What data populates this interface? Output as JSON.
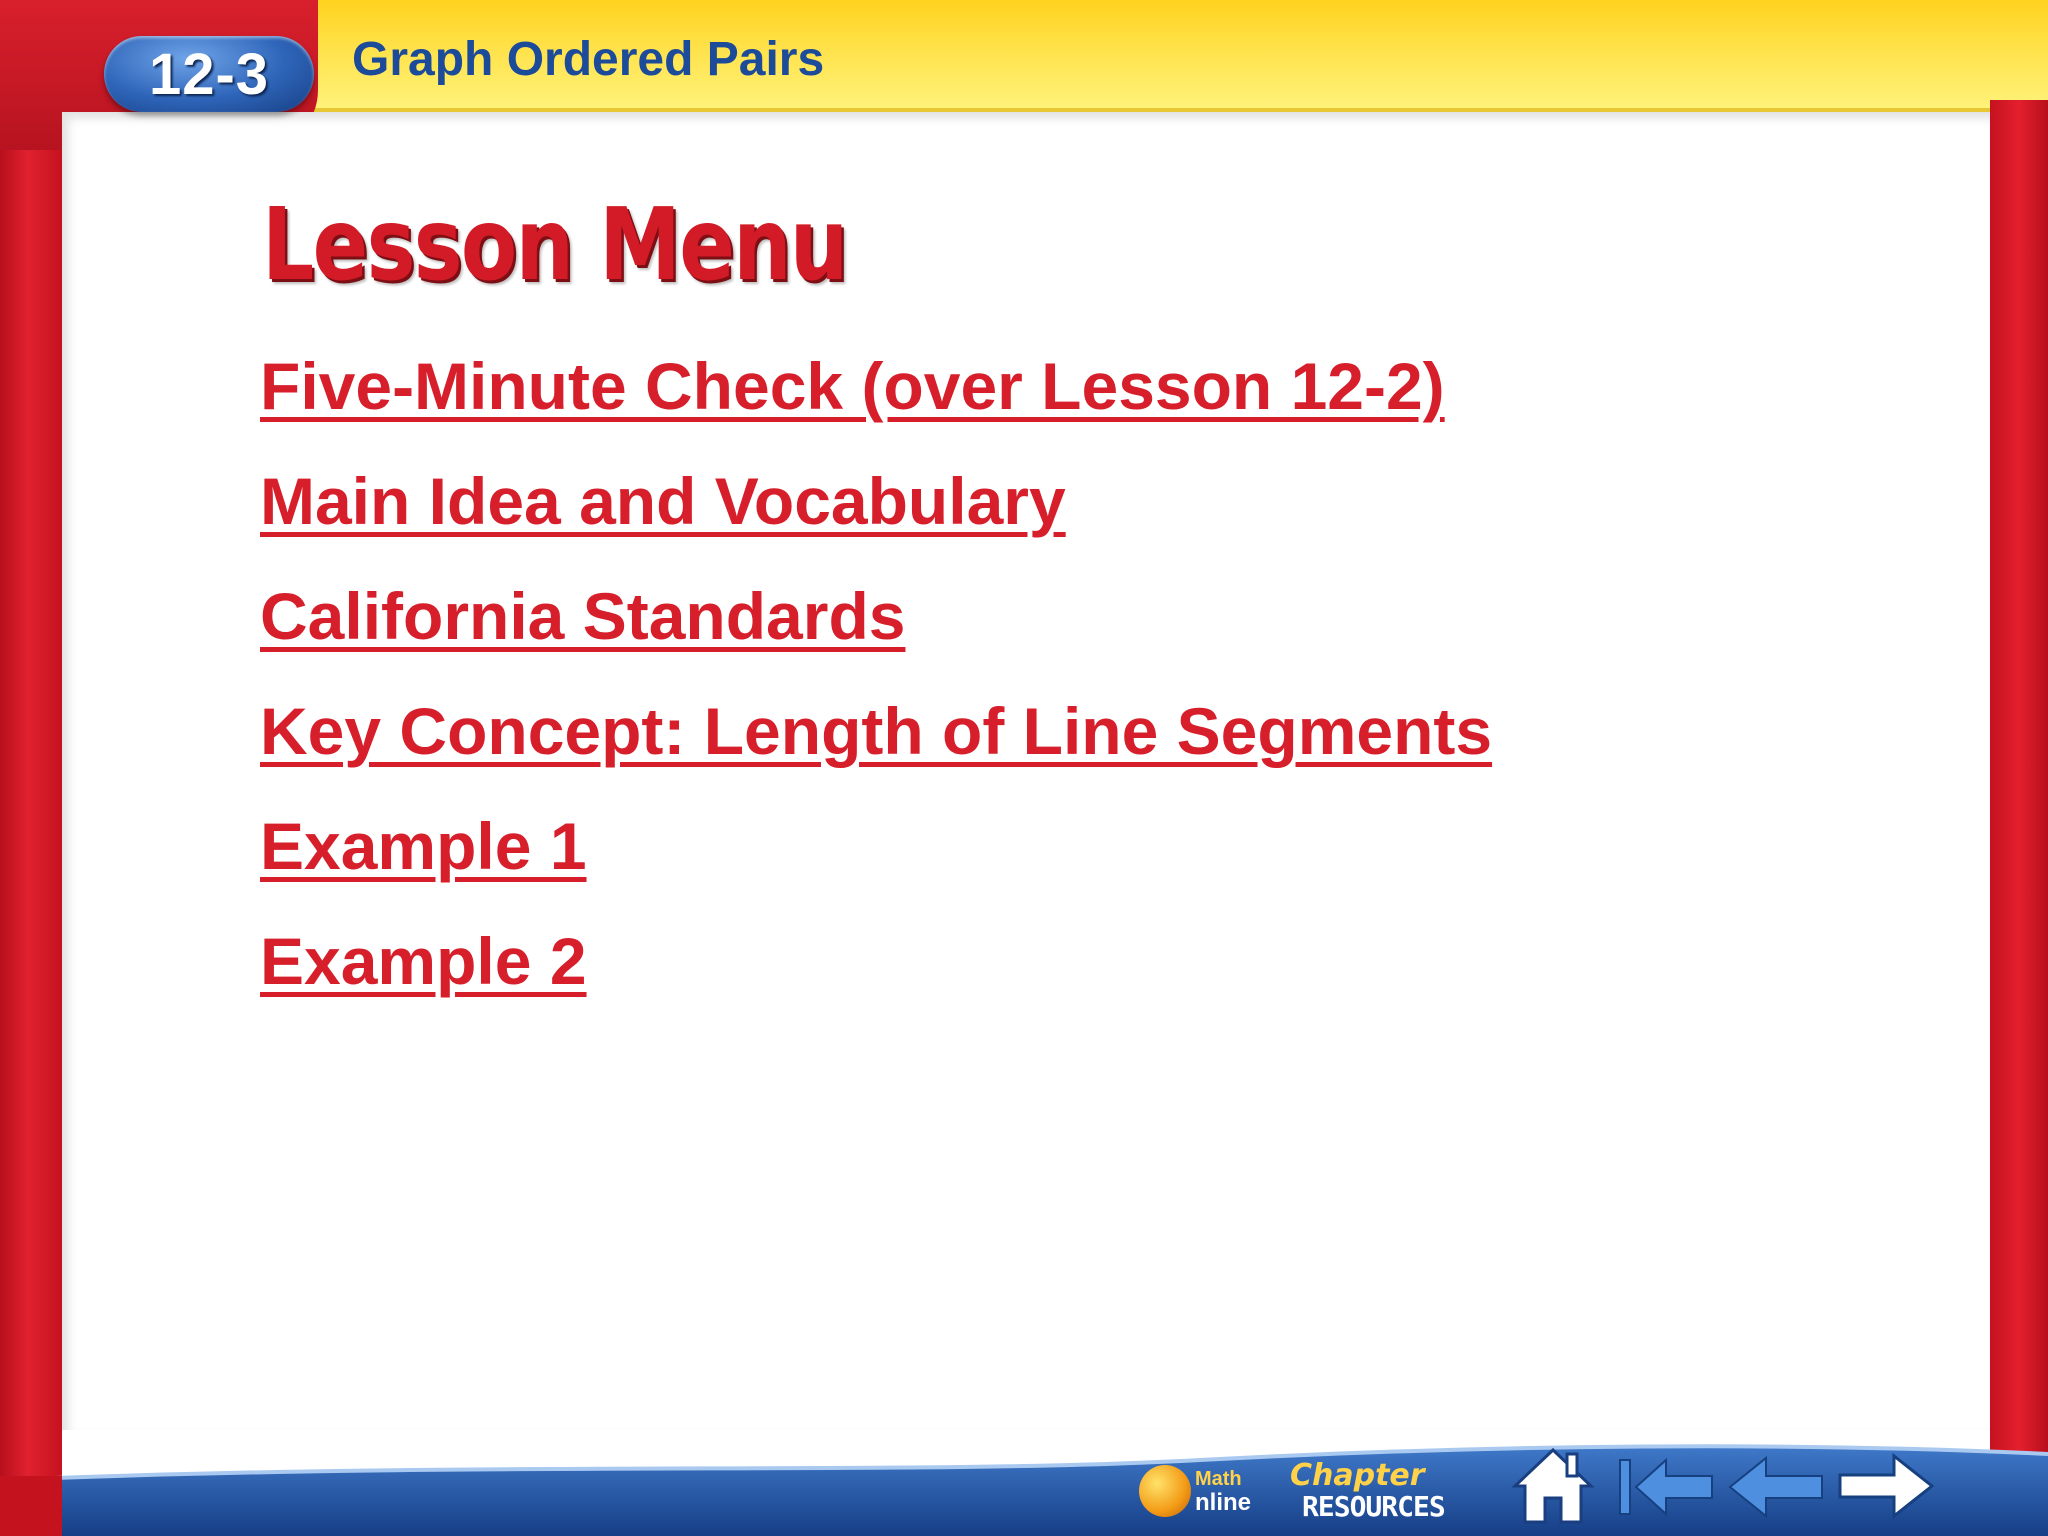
{
  "header": {
    "lesson_number": "12-3",
    "lesson_title": "Graph Ordered Pairs"
  },
  "heading": "Lesson Menu",
  "menu_items": [
    "Five-Minute Check (over Lesson 12-2)",
    "Main Idea and Vocabulary",
    "California Standards",
    "Key Concept: Length of Line Segments",
    "Example 1",
    "Example 2"
  ],
  "nav": {
    "math_online_top": "Math",
    "math_online_bottom": "nline",
    "chapter_resources_top": "Chapter",
    "chapter_resources_bottom": "RESOURCES",
    "icons": [
      "math-online-icon",
      "home-icon",
      "first-slide-icon",
      "previous-arrow-icon",
      "next-arrow-icon"
    ]
  },
  "colors": {
    "frame_red": "#d31b27",
    "header_yellow": "#ffe24a",
    "title_blue": "#1c4b9a",
    "link_red": "#d71f2b",
    "nav_blue": "#1f4f9c"
  }
}
